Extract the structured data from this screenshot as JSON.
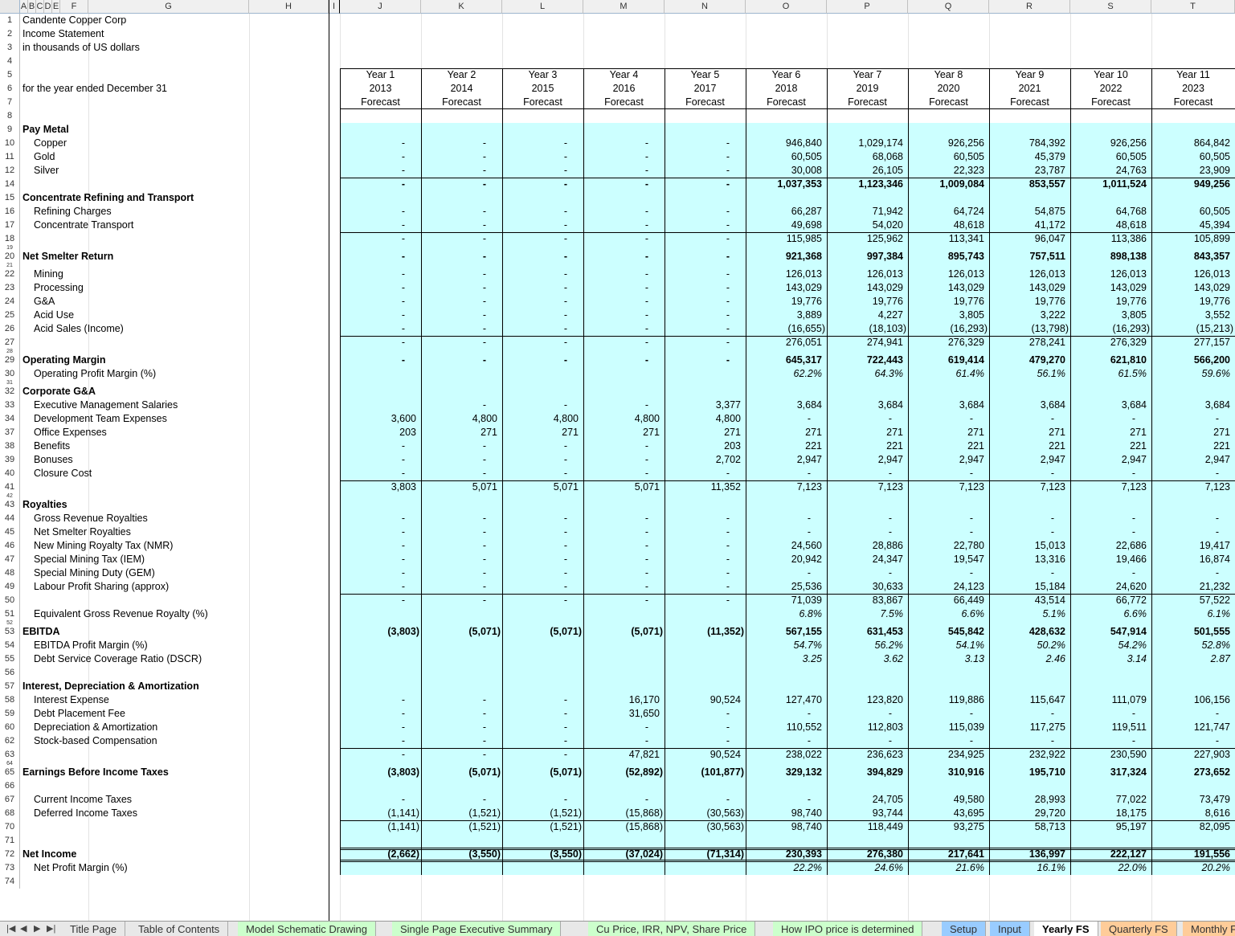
{
  "columns": [
    "A",
    "B",
    "C",
    "D",
    "E",
    "F",
    "G",
    "H",
    "I",
    "J",
    "K",
    "L",
    "M",
    "N",
    "O",
    "P",
    "Q",
    "R",
    "S",
    "T"
  ],
  "title_rows": [
    {
      "row": "1",
      "text": "Candente Copper Corp"
    },
    {
      "row": "2",
      "text": "Income Statement"
    },
    {
      "row": "3",
      "text": "in thousands of US dollars"
    }
  ],
  "period_label": "for the year ended December 31",
  "years": [
    {
      "y": "Year 1",
      "d": "2013",
      "f": "Forecast"
    },
    {
      "y": "Year 2",
      "d": "2014",
      "f": "Forecast"
    },
    {
      "y": "Year 3",
      "d": "2015",
      "f": "Forecast"
    },
    {
      "y": "Year 4",
      "d": "2016",
      "f": "Forecast"
    },
    {
      "y": "Year 5",
      "d": "2017",
      "f": "Forecast"
    },
    {
      "y": "Year 6",
      "d": "2018",
      "f": "Forecast"
    },
    {
      "y": "Year 7",
      "d": "2019",
      "f": "Forecast"
    },
    {
      "y": "Year 8",
      "d": "2020",
      "f": "Forecast"
    },
    {
      "y": "Year 9",
      "d": "2021",
      "f": "Forecast"
    },
    {
      "y": "Year 10",
      "d": "2022",
      "f": "Forecast"
    },
    {
      "y": "Year 11",
      "d": "2023",
      "f": "Forecast"
    }
  ],
  "header_rows": [
    "5",
    "6",
    "7",
    "8"
  ],
  "rows": [
    {
      "r": "9",
      "label": "Pay Metal",
      "style": "b",
      "vals": []
    },
    {
      "r": "10",
      "label": "Copper",
      "style": "ind",
      "vals": [
        "-",
        "-",
        "-",
        "-",
        "-",
        "946,840",
        "1,029,174",
        "926,256",
        "784,392",
        "926,256",
        "864,842"
      ]
    },
    {
      "r": "11",
      "label": "Gold",
      "style": "ind",
      "vals": [
        "-",
        "-",
        "-",
        "-",
        "-",
        "60,505",
        "68,068",
        "60,505",
        "45,379",
        "60,505",
        "60,505"
      ]
    },
    {
      "r": "12",
      "label": "Silver",
      "style": "ind",
      "vals": [
        "-",
        "-",
        "-",
        "-",
        "-",
        "30,008",
        "26,105",
        "22,323",
        "23,787",
        "24,763",
        "23,909"
      ]
    },
    {
      "r": "14",
      "label": "",
      "style": "tot",
      "vals": [
        "-",
        "-",
        "-",
        "-",
        "-",
        "1,037,353",
        "1,123,346",
        "1,009,084",
        "853,557",
        "1,011,524",
        "949,256"
      ]
    },
    {
      "r": "15",
      "label": "Concentrate Refining and Transport",
      "style": "b",
      "vals": []
    },
    {
      "r": "16",
      "label": "Refining Charges",
      "style": "ind",
      "vals": [
        "-",
        "-",
        "-",
        "-",
        "-",
        "66,287",
        "71,942",
        "64,724",
        "54,875",
        "64,768",
        "60,505"
      ]
    },
    {
      "r": "17",
      "label": "Concentrate Transport",
      "style": "ind",
      "vals": [
        "-",
        "-",
        "-",
        "-",
        "-",
        "49,698",
        "54,020",
        "48,618",
        "41,172",
        "48,618",
        "45,394"
      ]
    },
    {
      "r": "18",
      "label": "",
      "style": "sum",
      "vals": [
        "-",
        "-",
        "-",
        "-",
        "-",
        "115,985",
        "125,962",
        "113,341",
        "96,047",
        "113,386",
        "105,899"
      ]
    },
    {
      "r": "19",
      "label": "",
      "style": "thin",
      "vals": []
    },
    {
      "r": "20",
      "label": "Net Smelter Return",
      "style": "btot",
      "vals": [
        "-",
        "-",
        "-",
        "-",
        "-",
        "921,368",
        "997,384",
        "895,743",
        "757,511",
        "898,138",
        "843,357"
      ]
    },
    {
      "r": "21",
      "label": "",
      "style": "thin",
      "vals": []
    },
    {
      "r": "22",
      "label": "Mining",
      "style": "ind",
      "vals": [
        "-",
        "-",
        "-",
        "-",
        "-",
        "126,013",
        "126,013",
        "126,013",
        "126,013",
        "126,013",
        "126,013"
      ]
    },
    {
      "r": "23",
      "label": "Processing",
      "style": "ind",
      "vals": [
        "-",
        "-",
        "-",
        "-",
        "-",
        "143,029",
        "143,029",
        "143,029",
        "143,029",
        "143,029",
        "143,029"
      ]
    },
    {
      "r": "24",
      "label": "G&A",
      "style": "ind",
      "vals": [
        "-",
        "-",
        "-",
        "-",
        "-",
        "19,776",
        "19,776",
        "19,776",
        "19,776",
        "19,776",
        "19,776"
      ]
    },
    {
      "r": "25",
      "label": "Acid Use",
      "style": "ind",
      "vals": [
        "-",
        "-",
        "-",
        "-",
        "-",
        "3,889",
        "4,227",
        "3,805",
        "3,222",
        "3,805",
        "3,552"
      ]
    },
    {
      "r": "26",
      "label": "Acid Sales (Income)",
      "style": "ind",
      "vals": [
        "-",
        "-",
        "-",
        "-",
        "-",
        "(16,655)",
        "(18,103)",
        "(16,293)",
        "(13,798)",
        "(16,293)",
        "(15,213)"
      ]
    },
    {
      "r": "27",
      "label": "",
      "style": "sum",
      "vals": [
        "-",
        "-",
        "-",
        "-",
        "-",
        "276,051",
        "274,941",
        "276,329",
        "278,241",
        "276,329",
        "277,157"
      ]
    },
    {
      "r": "28",
      "label": "",
      "style": "thin",
      "vals": []
    },
    {
      "r": "29",
      "label": "Operating Margin",
      "style": "btot",
      "vals": [
        "-",
        "-",
        "-",
        "-",
        "-",
        "645,317",
        "722,443",
        "619,414",
        "479,270",
        "621,810",
        "566,200"
      ]
    },
    {
      "r": "30",
      "label": "Operating Profit Margin (%)",
      "style": "indi",
      "vals": [
        "",
        "",
        "",
        "",
        "",
        "62.2%",
        "64.3%",
        "61.4%",
        "56.1%",
        "61.5%",
        "59.6%"
      ]
    },
    {
      "r": "31",
      "label": "",
      "style": "thin",
      "vals": []
    },
    {
      "r": "32",
      "label": "Corporate G&A",
      "style": "b",
      "vals": []
    },
    {
      "r": "33",
      "label": "Executive Management Salaries",
      "style": "ind",
      "vals": [
        "",
        "-",
        "-",
        "-",
        "3,377",
        "3,684",
        "3,684",
        "3,684",
        "3,684",
        "3,684",
        "3,684"
      ]
    },
    {
      "r": "34",
      "label": "Development Team Expenses",
      "style": "ind",
      "vals": [
        "3,600",
        "4,800",
        "4,800",
        "4,800",
        "4,800",
        "-",
        "-",
        "-",
        "-",
        "-",
        "-"
      ]
    },
    {
      "r": "37",
      "label": "Office Expenses",
      "style": "ind",
      "vals": [
        "203",
        "271",
        "271",
        "271",
        "271",
        "271",
        "271",
        "271",
        "271",
        "271",
        "271"
      ]
    },
    {
      "r": "38",
      "label": "Benefits",
      "style": "ind",
      "vals": [
        "-",
        "-",
        "-",
        "-",
        "203",
        "221",
        "221",
        "221",
        "221",
        "221",
        "221"
      ]
    },
    {
      "r": "39",
      "label": "Bonuses",
      "style": "ind",
      "vals": [
        "-",
        "-",
        "-",
        "-",
        "2,702",
        "2,947",
        "2,947",
        "2,947",
        "2,947",
        "2,947",
        "2,947"
      ]
    },
    {
      "r": "40",
      "label": "Closure Cost",
      "style": "ind",
      "vals": [
        "-",
        "-",
        "-",
        "-",
        "-",
        "-",
        "-",
        "-",
        "-",
        "-",
        "-"
      ]
    },
    {
      "r": "41",
      "label": "",
      "style": "sum",
      "vals": [
        "3,803",
        "5,071",
        "5,071",
        "5,071",
        "11,352",
        "7,123",
        "7,123",
        "7,123",
        "7,123",
        "7,123",
        "7,123"
      ]
    },
    {
      "r": "42",
      "label": "",
      "style": "thin",
      "vals": []
    },
    {
      "r": "43",
      "label": "Royalties",
      "style": "b",
      "vals": []
    },
    {
      "r": "44",
      "label": "Gross Revenue Royalties",
      "style": "ind",
      "vals": [
        "-",
        "-",
        "-",
        "-",
        "-",
        "-",
        "-",
        "-",
        "-",
        "-",
        "-"
      ]
    },
    {
      "r": "45",
      "label": "Net Smelter Royalties",
      "style": "ind",
      "vals": [
        "-",
        "-",
        "-",
        "-",
        "-",
        "-",
        "-",
        "-",
        "-",
        "-",
        "-"
      ]
    },
    {
      "r": "46",
      "label": "New Mining Royalty Tax (NMR)",
      "style": "ind",
      "vals": [
        "-",
        "-",
        "-",
        "-",
        "-",
        "24,560",
        "28,886",
        "22,780",
        "15,013",
        "22,686",
        "19,417"
      ]
    },
    {
      "r": "47",
      "label": "Special Mining Tax (IEM)",
      "style": "ind",
      "vals": [
        "-",
        "-",
        "-",
        "-",
        "-",
        "20,942",
        "24,347",
        "19,547",
        "13,316",
        "19,466",
        "16,874"
      ]
    },
    {
      "r": "48",
      "label": "Special Mining Duty (GEM)",
      "style": "ind",
      "vals": [
        "-",
        "-",
        "-",
        "-",
        "-",
        "-",
        "-",
        "-",
        "-",
        "-",
        "-"
      ]
    },
    {
      "r": "49",
      "label": "Labour Profit Sharing (approx)",
      "style": "ind",
      "vals": [
        "-",
        "-",
        "-",
        "-",
        "-",
        "25,536",
        "30,633",
        "24,123",
        "15,184",
        "24,620",
        "21,232"
      ]
    },
    {
      "r": "50",
      "label": "",
      "style": "sum",
      "vals": [
        "-",
        "-",
        "-",
        "-",
        "-",
        "71,039",
        "83,867",
        "66,449",
        "43,514",
        "66,772",
        "57,522"
      ]
    },
    {
      "r": "51",
      "label": "Equivalent Gross Revenue Royalty (%)",
      "style": "indi",
      "vals": [
        "",
        "",
        "",
        "",
        "",
        "6.8%",
        "7.5%",
        "6.6%",
        "5.1%",
        "6.6%",
        "6.1%"
      ]
    },
    {
      "r": "52",
      "label": "",
      "style": "thin",
      "vals": []
    },
    {
      "r": "53",
      "label": "EBITDA",
      "style": "btot",
      "vals": [
        "(3,803)",
        "(5,071)",
        "(5,071)",
        "(5,071)",
        "(11,352)",
        "567,155",
        "631,453",
        "545,842",
        "428,632",
        "547,914",
        "501,555"
      ]
    },
    {
      "r": "54",
      "label": "EBITDA Profit Margin (%)",
      "style": "indi",
      "vals": [
        "",
        "",
        "",
        "",
        "",
        "54.7%",
        "56.2%",
        "54.1%",
        "50.2%",
        "54.2%",
        "52.8%"
      ]
    },
    {
      "r": "55",
      "label": "Debt Service Coverage Ratio (DSCR)",
      "style": "indi",
      "vals": [
        "",
        "",
        "",
        "",
        "",
        "3.25",
        "3.62",
        "3.13",
        "2.46",
        "3.14",
        "2.87"
      ]
    },
    {
      "r": "56",
      "label": "",
      "style": "blank",
      "vals": []
    },
    {
      "r": "57",
      "label": "Interest, Depreciation & Amortization",
      "style": "b",
      "vals": []
    },
    {
      "r": "58",
      "label": "Interest Expense",
      "style": "ind",
      "vals": [
        "-",
        "-",
        "-",
        "16,170",
        "90,524",
        "127,470",
        "123,820",
        "119,886",
        "115,647",
        "111,079",
        "106,156"
      ]
    },
    {
      "r": "59",
      "label": "Debt Placement Fee",
      "style": "ind",
      "vals": [
        "-",
        "-",
        "-",
        "31,650",
        "-",
        "-",
        "-",
        "-",
        "-",
        "-",
        "-"
      ]
    },
    {
      "r": "60",
      "label": "Depreciation & Amortization",
      "style": "ind",
      "vals": [
        "-",
        "-",
        "-",
        "-",
        "-",
        "110,552",
        "112,803",
        "115,039",
        "117,275",
        "119,511",
        "121,747"
      ]
    },
    {
      "r": "62",
      "label": "Stock-based Compensation",
      "style": "ind",
      "vals": [
        "-",
        "-",
        "-",
        "-",
        "-",
        "-",
        "-",
        "-",
        "-",
        "-",
        "-"
      ]
    },
    {
      "r": "63",
      "label": "",
      "style": "sum",
      "vals": [
        "-",
        "-",
        "-",
        "47,821",
        "90,524",
        "238,022",
        "236,623",
        "234,925",
        "232,922",
        "230,590",
        "227,903"
      ]
    },
    {
      "r": "64",
      "label": "",
      "style": "thin",
      "vals": []
    },
    {
      "r": "65",
      "label": "Earnings Before Income Taxes",
      "style": "btot",
      "vals": [
        "(3,803)",
        "(5,071)",
        "(5,071)",
        "(52,892)",
        "(101,877)",
        "329,132",
        "394,829",
        "310,916",
        "195,710",
        "317,324",
        "273,652"
      ]
    },
    {
      "r": "66",
      "label": "",
      "style": "blank",
      "vals": []
    },
    {
      "r": "67",
      "label": "Current Income Taxes",
      "style": "ind",
      "vals": [
        "-",
        "-",
        "-",
        "-",
        "-",
        "-",
        "24,705",
        "49,580",
        "28,993",
        "77,022",
        "73,479"
      ]
    },
    {
      "r": "68",
      "label": "Deferred Income Taxes",
      "style": "ind",
      "vals": [
        "(1,141)",
        "(1,521)",
        "(1,521)",
        "(15,868)",
        "(30,563)",
        "98,740",
        "93,744",
        "43,695",
        "29,720",
        "18,175",
        "8,616"
      ]
    },
    {
      "r": "70",
      "label": "",
      "style": "sum",
      "vals": [
        "(1,141)",
        "(1,521)",
        "(1,521)",
        "(15,868)",
        "(30,563)",
        "98,740",
        "118,449",
        "93,275",
        "58,713",
        "95,197",
        "82,095"
      ]
    },
    {
      "r": "71",
      "label": "",
      "style": "blank",
      "vals": []
    },
    {
      "r": "72",
      "label": "Net Income",
      "style": "net",
      "vals": [
        "(2,662)",
        "(3,550)",
        "(3,550)",
        "(37,024)",
        "(71,314)",
        "230,393",
        "276,380",
        "217,641",
        "136,997",
        "222,127",
        "191,556"
      ]
    },
    {
      "r": "73",
      "label": "Net Profit Margin (%)",
      "style": "indi",
      "vals": [
        "",
        "",
        "",
        "",
        "",
        "22.2%",
        "24.6%",
        "21.6%",
        "16.1%",
        "22.0%",
        "20.2%"
      ]
    },
    {
      "r": "74",
      "label": "",
      "style": "blank",
      "vals": []
    }
  ],
  "sheet_tabs": [
    "Title Page",
    "Table of Contents",
    "Model Schematic Drawing",
    "Single Page  Executive Summary",
    "Cu Price, IRR, NPV, Share Price",
    "How IPO price is determined",
    "Setup",
    "Input",
    "Yearly FS",
    "Quarterly FS",
    "Monthly FS"
  ],
  "active_tab": "Yearly FS",
  "tab_colors": {
    "Model Schematic Drawing": "#ccffcc",
    "Single Page  Executive Summary": "#ccffcc",
    "Cu Price, IRR, NPV, Share Price": "#ccffcc",
    "How IPO price is determined": "#ccffcc",
    "Setup": "#99ccff",
    "Input": "#99ccff",
    "Quarterly FS": "#ffcc99",
    "Monthly FS": "#ffcc99"
  },
  "nav_icons": [
    "first-sheet-icon",
    "prev-sheet-icon",
    "next-sheet-icon",
    "last-sheet-icon"
  ]
}
